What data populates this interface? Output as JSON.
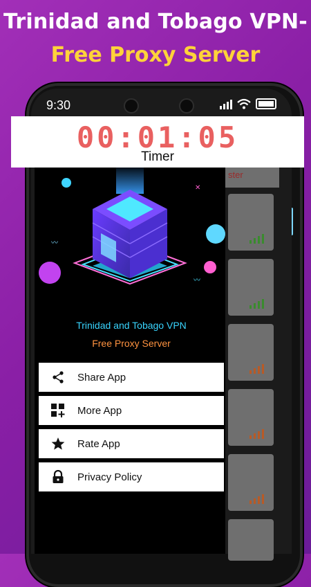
{
  "promo": {
    "line1": "Trinidad and Tobago VPN-",
    "line2": "Free Proxy Server"
  },
  "status_bar": {
    "time": "9:30",
    "icons": [
      "signal-icon",
      "wifi-icon",
      "battery-icon"
    ]
  },
  "timer": {
    "value": "00:01:05",
    "label": "Timer"
  },
  "background_list": {
    "partial_label": "ster"
  },
  "drawer": {
    "app_title": "Trinidad and Tobago VPN",
    "app_subtitle": "Free Proxy Server",
    "menu": [
      {
        "label": "Share App",
        "icon": "share-icon"
      },
      {
        "label": "More App",
        "icon": "grid-plus-icon"
      },
      {
        "label": "Rate App",
        "icon": "star-icon"
      },
      {
        "label": "Privacy Policy",
        "icon": "lock-icon"
      }
    ]
  },
  "colors": {
    "accent_cyan": "#39d5ff",
    "accent_orange": "#ff9340",
    "timer_red": "#e96060",
    "promo_yellow": "#ffd23a"
  }
}
